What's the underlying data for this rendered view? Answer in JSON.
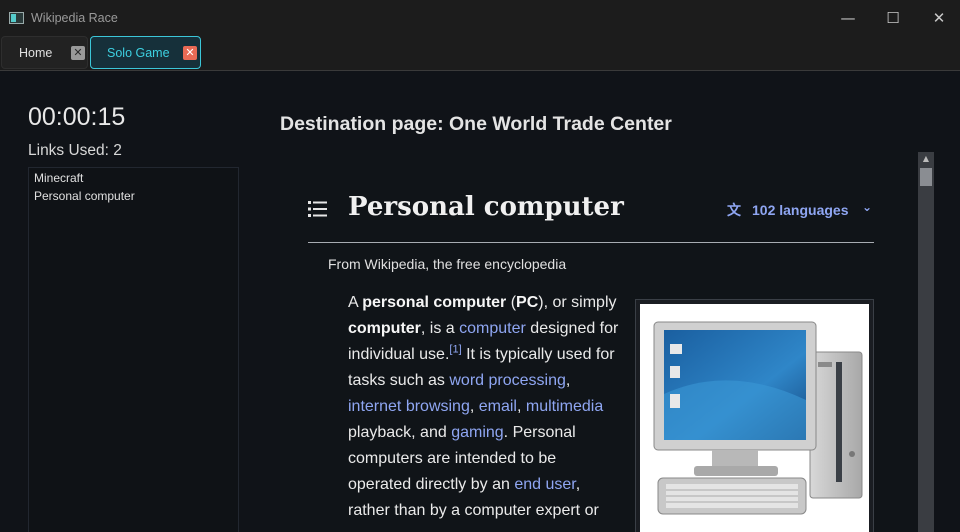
{
  "window": {
    "title": "Wikipedia Race",
    "minimize_icon": "minimize-icon",
    "maximize_icon": "maximize-icon",
    "close_icon": "close-icon",
    "minimize_glyph": "—",
    "maximize_glyph": "☐",
    "close_glyph": "✕"
  },
  "tabs": [
    {
      "label": "Home",
      "close_glyph": "✕",
      "active": false
    },
    {
      "label": "Solo Game",
      "close_glyph": "✕",
      "active": true
    }
  ],
  "game": {
    "timer": "00:00:15",
    "links_used_label": "Links Used: 2",
    "history": [
      "Minecraft",
      "Personal computer"
    ],
    "destination": "Destination page: One World Trade Center"
  },
  "article": {
    "title": "Personal computer",
    "languages": "102 languages",
    "tagline": "From Wikipedia, the free encyclopedia",
    "p": {
      "t1": "A ",
      "b1": "personal computer",
      "t2": " (",
      "b2": "PC",
      "t3": "), or simply ",
      "b3": "computer",
      "t4": ", is a ",
      "l1": "computer",
      "t5": " designed for individual use.",
      "sup1": "[1]",
      "t6": " It is typically used for tasks such as ",
      "l2": "word processing",
      "t7": ", ",
      "l3": "internet browsing",
      "t8": ", ",
      "l4": "email",
      "t9": ", ",
      "l5": "multimedia",
      "t10": " playback, and ",
      "l6": "gaming",
      "t11": ". Personal computers are intended to be operated directly by an ",
      "l7": "end user",
      "t12": ", rather than by a computer expert or"
    }
  },
  "colors": {
    "accent": "#3dd0e0",
    "link": "#8fa6f2",
    "close_active": "#e96a55",
    "background": "#101318"
  }
}
